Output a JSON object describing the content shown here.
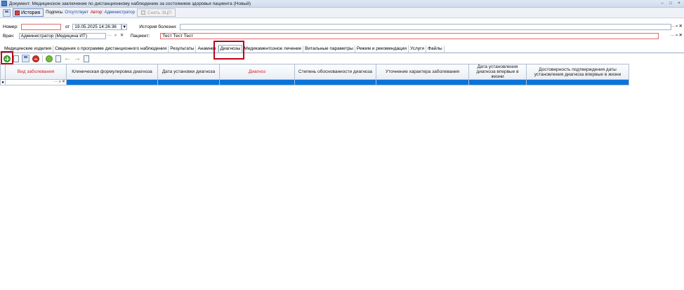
{
  "window": {
    "title": "Документ: Медицинское заключение по дистанционному наблюдению за состоянием здоровья пациента (Новый)",
    "buttons": [
      "–",
      "□",
      "×"
    ]
  },
  "toolbar": {
    "history_label": "История",
    "signature_label": "Подпись:",
    "signature_value": "Отсутствует",
    "author_label": "Автор:",
    "author_value": "Администратор",
    "remove_ecp_label": "Снять ЭЦП"
  },
  "form": {
    "number_label": "Номер:",
    "number_value": "",
    "from_label": "от",
    "date_value": "19.05.2025 14:26:36",
    "history_label": "История болезни:",
    "history_value": "",
    "doctor_label": "Врач:",
    "doctor_value": "Администратор (Медицина ИТ)",
    "patient_label": "Пациент:",
    "patient_value": "Тест Тест Тест",
    "lookup_glyphs": [
      "···",
      "⌕",
      "✕"
    ]
  },
  "tabs": [
    "Медицинские изделия",
    "Сведения о программе дистанционного наблюдения",
    "Результаты",
    "Анамнез",
    "Диагнозы",
    "Медикаментозное лечение",
    "Витальные параметры",
    "Режим и рекомендации",
    "Услуги",
    "Файлы"
  ],
  "active_tab": "Диагнозы",
  "grid": {
    "columns": [
      "Вид заболевания",
      "Клиническая формулировка диагноза",
      "Дата установки диагноза",
      "Диагноз",
      "Степень обоснованности диагноза",
      "Уточнение характера заболевания",
      "Дата установления диагноза впервые в жизни",
      "Достоверность подтверждения даты установления диагноза впервые в жизни"
    ],
    "required_columns": [
      "Вид заболевания",
      "Диагноз"
    ],
    "row_indicator": "●"
  },
  "colors": {
    "selection": "#0a74da",
    "required": "#d02020",
    "highlight": "#c0001a"
  }
}
